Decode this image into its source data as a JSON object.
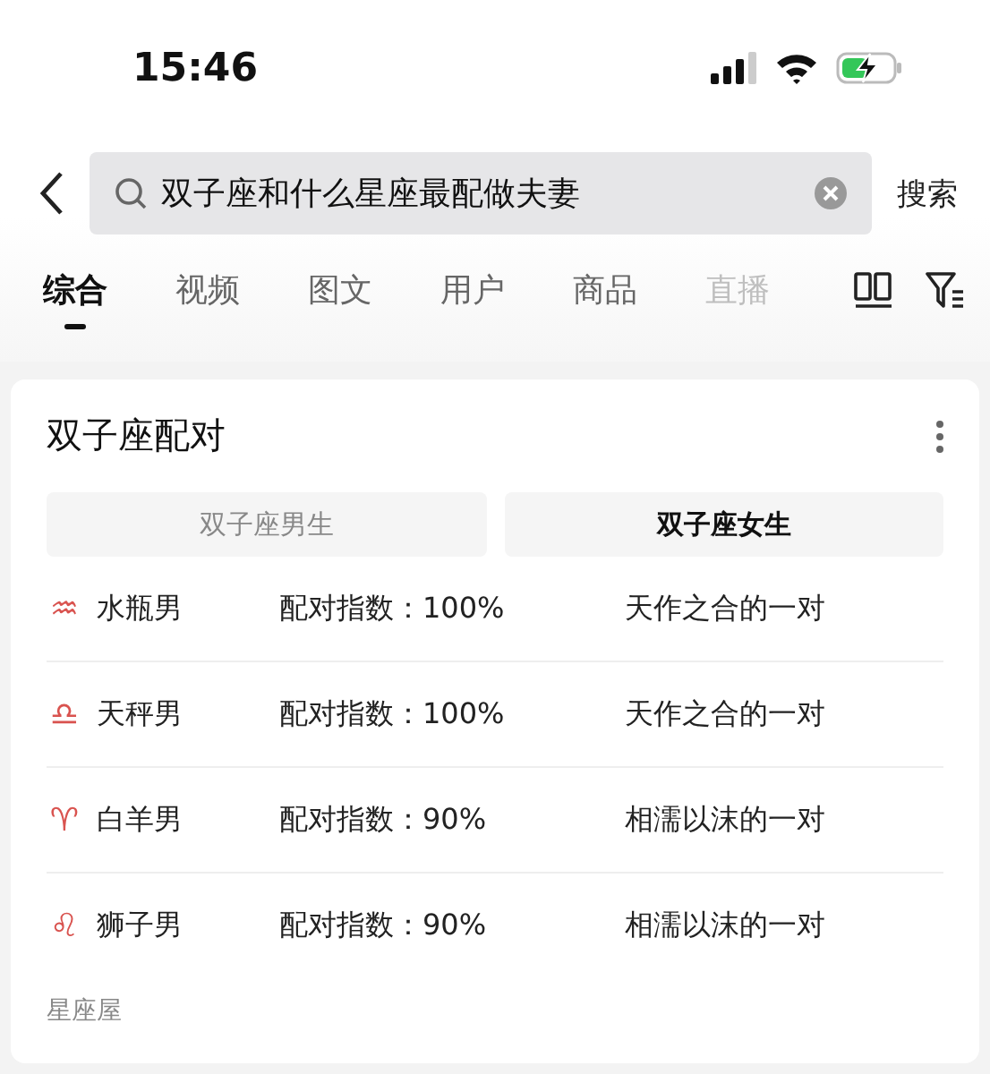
{
  "status_bar": {
    "time": "15:46",
    "battery_charging": true
  },
  "search": {
    "value": "双子座和什么星座最配做夫妻",
    "button": "搜索"
  },
  "tabs": [
    {
      "label": "综合",
      "selected": true
    },
    {
      "label": "视频",
      "selected": false
    },
    {
      "label": "图文",
      "selected": false
    },
    {
      "label": "用户",
      "selected": false
    },
    {
      "label": "商品",
      "selected": false
    },
    {
      "label": "直播",
      "selected": false
    }
  ],
  "card": {
    "title": "双子座配对",
    "toggles": [
      {
        "label": "双子座男生",
        "selected": false
      },
      {
        "label": "双子座女生",
        "selected": true
      }
    ],
    "rows": [
      {
        "symbol": "♒",
        "sign": "水瓶男",
        "score": "配对指数：100%",
        "verdict": "天作之合的一对"
      },
      {
        "symbol": "♎",
        "sign": "天秤男",
        "score": "配对指数：100%",
        "verdict": "天作之合的一对"
      },
      {
        "symbol": "♈",
        "sign": "白羊男",
        "score": "配对指数：90%",
        "verdict": "相濡以沫的一对"
      },
      {
        "symbol": "♌",
        "sign": "狮子男",
        "score": "配对指数：90%",
        "verdict": "相濡以沫的一对"
      }
    ],
    "source": "星座屋"
  }
}
